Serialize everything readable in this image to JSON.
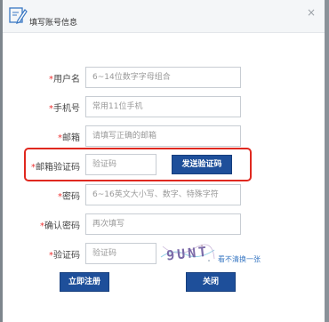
{
  "dialog": {
    "title": "填写账号信息",
    "close_glyph": "×"
  },
  "form": {
    "required_mark": "*",
    "username": {
      "label": "用户名",
      "placeholder": "6~14位数字字母组合"
    },
    "phone": {
      "label": "手机号",
      "placeholder": "常用11位手机"
    },
    "email": {
      "label": "邮箱",
      "placeholder": "请填写正确的邮箱"
    },
    "email_code": {
      "label": "邮箱验证码",
      "placeholder": "验证码",
      "send_button": "发送验证码"
    },
    "password": {
      "label": "密码",
      "placeholder": "6~16英文大小写、数字、特殊字符"
    },
    "confirm_password": {
      "label": "确认密码",
      "placeholder": "再次填写"
    },
    "captcha": {
      "label": "验证码",
      "placeholder": "验证码",
      "image_text": "9UNT",
      "refresh_link": "看不清换一张"
    }
  },
  "buttons": {
    "register": "立即注册",
    "close": "关闭"
  },
  "colors": {
    "primary_button": "#1e4f9a",
    "required_star": "#e33333",
    "highlight": "#e0281f",
    "link": "#3a78c3"
  }
}
